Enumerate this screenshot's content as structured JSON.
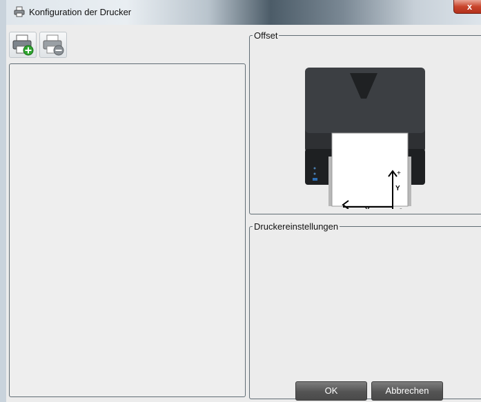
{
  "window": {
    "title": "Konfiguration der Drucker",
    "close_label": "x"
  },
  "toolbar": {
    "add_printer": "printer-add-icon",
    "remove_printer": "printer-remove-icon"
  },
  "groups": {
    "offset_label": "Offset",
    "settings_label": "Druckereinstellungen"
  },
  "offset_diagram": {
    "x_label": "X",
    "y_label": "Y",
    "x_plus": "+",
    "y_plus": "+",
    "minus": "-"
  },
  "buttons": {
    "ok": "OK",
    "cancel": "Abbrechen"
  }
}
